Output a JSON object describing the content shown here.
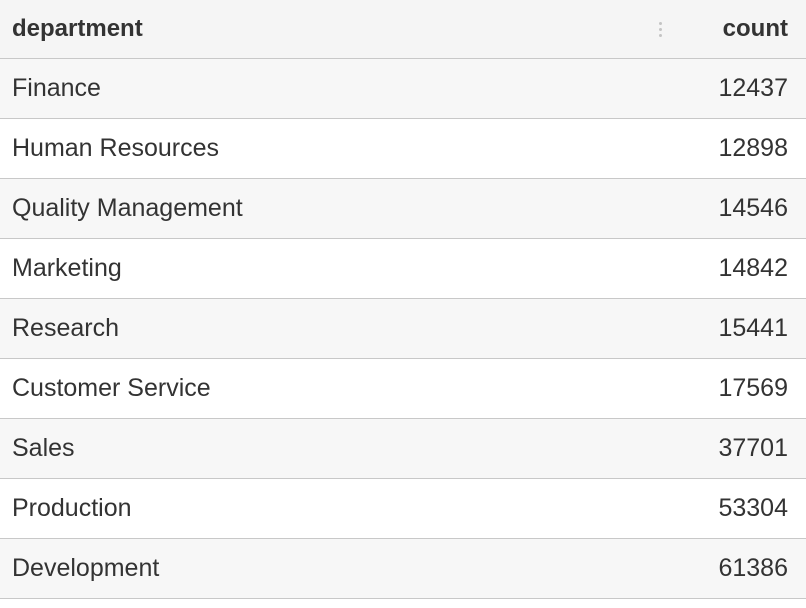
{
  "table": {
    "columns": {
      "department": "department",
      "count": "count"
    },
    "rows": [
      {
        "department": "Finance",
        "count": "12437"
      },
      {
        "department": "Human Resources",
        "count": "12898"
      },
      {
        "department": "Quality Management",
        "count": "14546"
      },
      {
        "department": "Marketing",
        "count": "14842"
      },
      {
        "department": "Research",
        "count": "15441"
      },
      {
        "department": "Customer Service",
        "count": "17569"
      },
      {
        "department": "Sales",
        "count": "37701"
      },
      {
        "department": "Production",
        "count": "53304"
      },
      {
        "department": "Development",
        "count": "61386"
      }
    ],
    "icons": {
      "column_menu": "vertical-ellipsis-icon"
    }
  }
}
